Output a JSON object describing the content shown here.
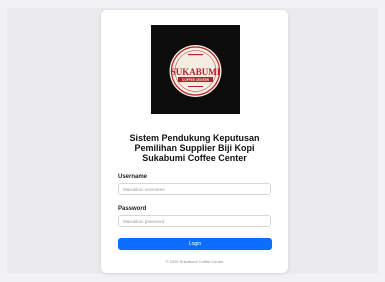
{
  "logo": {
    "brand_text": "SUKABUMI",
    "tagline": "COFFEE CENTER",
    "colors": {
      "background": "#0c0c0c",
      "seal_fill": "#f3ede2",
      "seal_ring": "#b0232b",
      "brand_text": "#b0232b"
    }
  },
  "login": {
    "title_line1": "Sistem Pendukung Keputusan",
    "title_line2": "Pemilihan Supplier Biji Kopi",
    "title_line3": "Sukabumi Coffee Center",
    "username_label": "Username",
    "username_placeholder": "Masukkan username",
    "password_label": "Password",
    "password_placeholder": "Masukkan password",
    "submit_label": "Login",
    "footer": "© 2025 Sukabumi Coffee Center"
  },
  "theme": {
    "primary": "#0d6efd",
    "page_background": "#ebebed"
  }
}
